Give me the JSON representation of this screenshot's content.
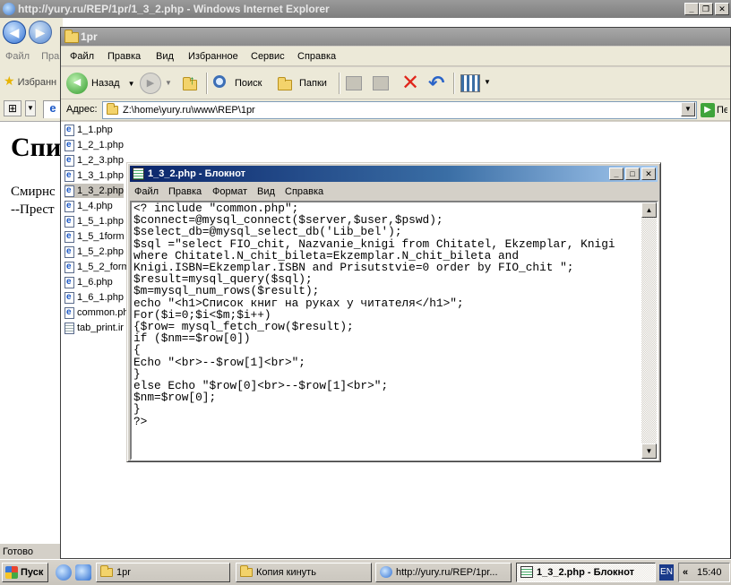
{
  "ie": {
    "title": "http://yury.ru/REP/1pr/1_3_2.php - Windows Internet Explorer",
    "menu": [
      "Файл",
      "Пра"
    ],
    "favorites_label": "Избранн",
    "heading": "Спи",
    "lines": [
      "Смирнс",
      "--Прест"
    ],
    "status": "Готово"
  },
  "explorer": {
    "title": "1pr",
    "menu": [
      "Файл",
      "Правка",
      "Вид",
      "Избранное",
      "Сервис",
      "Справка"
    ],
    "toolbar": {
      "back": "Назад",
      "search": "Поиск",
      "folders": "Папки"
    },
    "address_label": "Адрес:",
    "address": "Z:\\home\\yury.ru\\www\\REP\\1pr",
    "go": "Пе",
    "files": [
      {
        "name": "1_1.php",
        "icon": "ie-doc-icon"
      },
      {
        "name": "1_2_1.php",
        "icon": "ie-doc-icon"
      },
      {
        "name": "1_2_3.php",
        "icon": "ie-doc-icon"
      },
      {
        "name": "1_3_1.php",
        "icon": "ie-doc-icon"
      },
      {
        "name": "1_3_2.php",
        "icon": "ie-doc-icon",
        "selected": true
      },
      {
        "name": "1_4.php",
        "icon": "ie-doc-icon"
      },
      {
        "name": "1_5_1.php",
        "icon": "ie-doc-icon"
      },
      {
        "name": "1_5_1form",
        "icon": "ie-doc-icon"
      },
      {
        "name": "1_5_2.php",
        "icon": "ie-doc-icon"
      },
      {
        "name": "1_5_2_form",
        "icon": "ie-doc-icon"
      },
      {
        "name": "1_6.php",
        "icon": "ie-doc-icon"
      },
      {
        "name": "1_6_1.php",
        "icon": "ie-doc-icon"
      },
      {
        "name": "common.ph",
        "icon": "ie-doc-icon"
      },
      {
        "name": "tab_print.ir",
        "icon": "text-doc-icon"
      }
    ]
  },
  "notepad": {
    "title": "1_3_2.php - Блокнот",
    "menu": [
      "Файл",
      "Правка",
      "Формат",
      "Вид",
      "Справка"
    ],
    "lines": [
      "<? include \"common.php\";",
      "$connect=@mysql_connect($server,$user,$pswd);",
      "$select_db=@mysql_select_db('Lib_bel');",
      "$sql =\"select FIO_chit, Nazvanie_knigi from Chitatel, Ekzemplar, Knigi",
      "where Chitatel.N_chit_bileta=Ekzemplar.N_chit_bileta and",
      "Knigi.ISBN=Ekzemplar.ISBN and Prisutstvie=0 order by FIO_chit \";",
      "$result=mysql_query($sql);",
      "$m=mysql_num_rows($result);",
      "echo \"<h1>Список книг на руках у читателя</h1>\";",
      "For($i=0;$i<$m;$i++)",
      "{$row= mysql_fetch_row($result);",
      "if ($nm==$row[0])",
      "{",
      "Echo \"<br>--$row[1]<br>\";",
      "}",
      "else Echo \"$row[0]<br>--$row[1]<br>\";",
      "$nm=$row[0];",
      "}",
      "?>"
    ]
  },
  "taskbar": {
    "start": "Пуск",
    "tasks": [
      {
        "label": "1pr",
        "icon": "folder-icon"
      },
      {
        "label": "Копия кинуть",
        "icon": "folder-icon"
      },
      {
        "label": "http://yury.ru/REP/1pr...",
        "icon": "ie-icon"
      },
      {
        "label": "1_3_2.php - Блокнот",
        "icon": "notepad-icon",
        "active": true
      }
    ],
    "lang": "EN",
    "clock": "15:40"
  }
}
